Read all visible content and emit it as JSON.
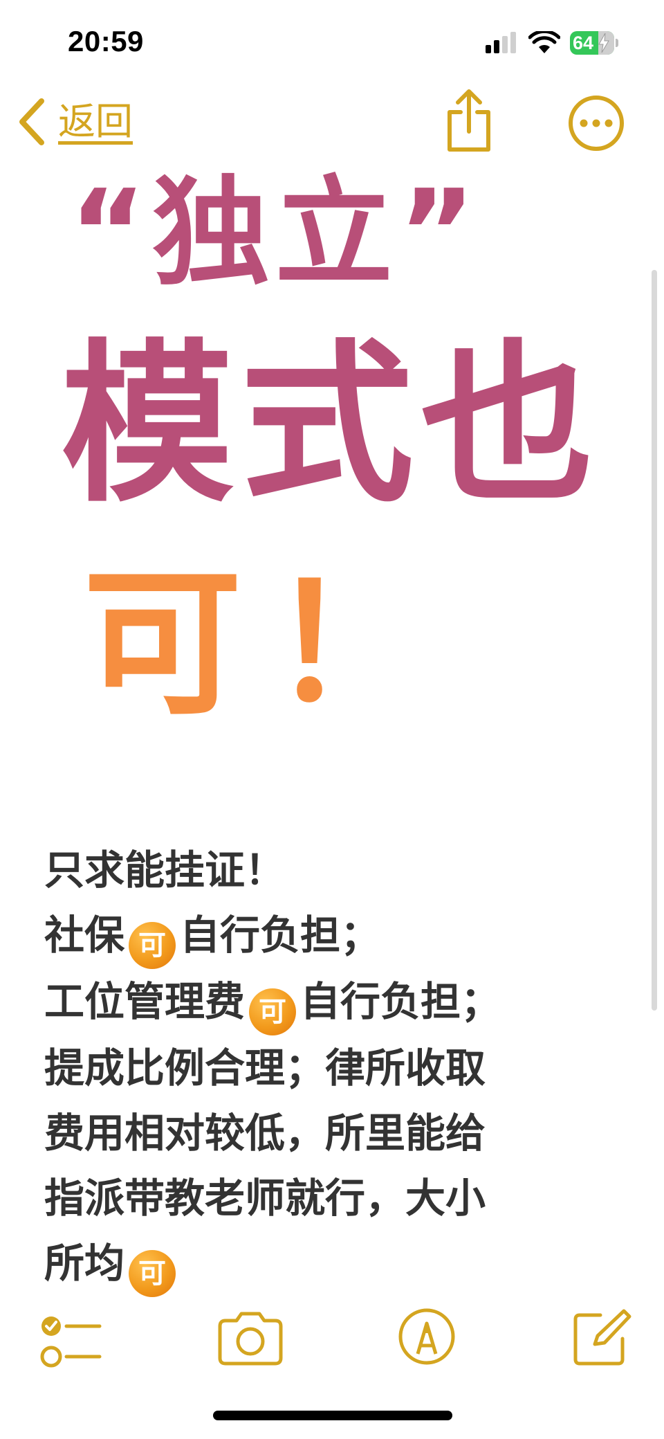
{
  "status_bar": {
    "time": "20:59",
    "battery_percent": 64,
    "battery_label": "64",
    "signal_icon": "cellular-signal-icon",
    "wifi_icon": "wifi-icon",
    "charging_icon": "lightning-bolt-icon"
  },
  "nav": {
    "back_label": "返回",
    "back_icon": "chevron-left-icon",
    "share_icon": "share-icon",
    "more_icon": "ellipsis-circle-icon"
  },
  "handwriting": {
    "line1": "“独立”",
    "line2": "模式也",
    "line3": "可！",
    "colors": {
      "primary": "#a8285a",
      "secondary": "#f47a1e"
    }
  },
  "note": {
    "lines": [
      {
        "before": "只求能挂证！",
        "emoji": "",
        "after": ""
      },
      {
        "before": "社保",
        "emoji": "可",
        "after": "自行负担；"
      },
      {
        "before": "工位管理费",
        "emoji": "可",
        "after": "自行负担；"
      },
      {
        "before": "提成比例合理；律所收取",
        "emoji": "",
        "after": ""
      },
      {
        "before": "费用相对较低，所里能给",
        "emoji": "",
        "after": ""
      },
      {
        "before": "指派带教老师就行，大小",
        "emoji": "",
        "after": ""
      },
      {
        "before": "所均",
        "emoji": "可",
        "after": ""
      }
    ]
  },
  "toolbar": {
    "checklist_icon": "checklist-icon",
    "camera_icon": "camera-icon",
    "markup_icon": "markup-pen-icon",
    "compose_icon": "compose-icon"
  },
  "colors": {
    "accent": "#d4a520",
    "text": "#333333"
  }
}
